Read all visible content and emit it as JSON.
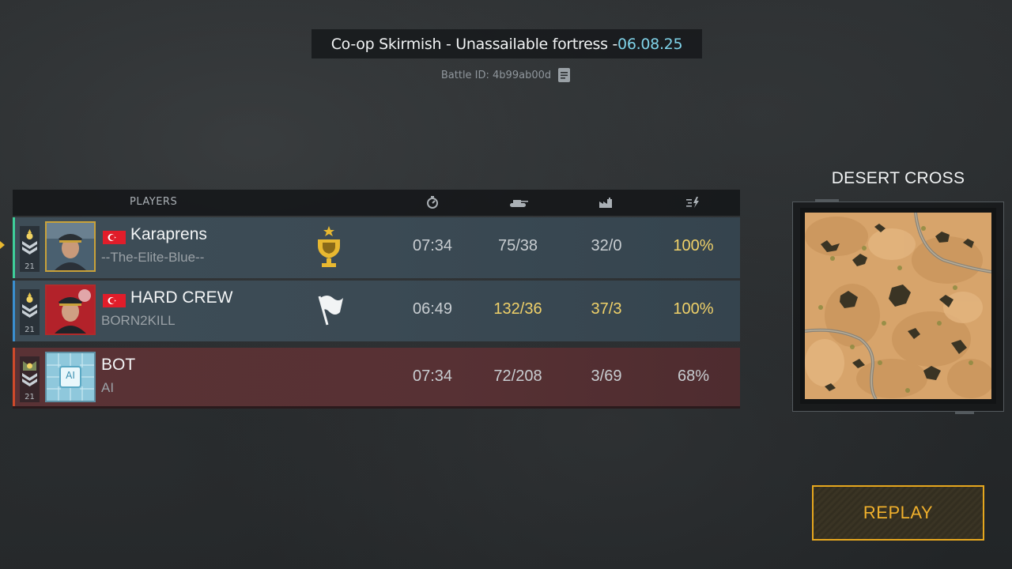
{
  "header": {
    "title_prefix": "Co-op Skirmish - Unassailable fortress - ",
    "title_date": "06.08.25",
    "battle_id": "Battle ID: 4b99ab00d"
  },
  "table": {
    "columns": {
      "players": "PLAYERS",
      "time_icon": "stopwatch-icon",
      "tanks_icon": "tank-icon",
      "buildings_icon": "factory-icon",
      "efficiency_icon": "energy-icon"
    },
    "rows": [
      {
        "rank": "21",
        "name": "Karaprens",
        "clan": "--The-Elite-Blue--",
        "flag": "turkey",
        "badge": "trophy-icon",
        "time": "07:34",
        "units": "75/38",
        "buildings": "32/0",
        "efficiency": "100%"
      },
      {
        "rank": "21",
        "name": "HARD CREW",
        "clan": "BORN2KILL",
        "flag": "turkey",
        "badge": "surrender-flag-icon",
        "time": "06:49",
        "units": "132/36",
        "buildings": "37/3",
        "efficiency": "100%"
      },
      {
        "rank": "21",
        "name": "BOT",
        "clan": "AI",
        "avatar_text": "AI",
        "time": "07:34",
        "units": "72/208",
        "buildings": "3/69",
        "efficiency": "68%"
      }
    ]
  },
  "map": {
    "name": "DESERT CROSS"
  },
  "actions": {
    "replay": "REPLAY"
  },
  "colors": {
    "gold_value": "#f0d169",
    "date_accent": "#7fd2e8",
    "replay_accent": "#f0b02c",
    "ally_edge_1": "#3ecf9a",
    "ally_edge_2": "#3a8fd0",
    "enemy_edge": "#d04a2a"
  }
}
